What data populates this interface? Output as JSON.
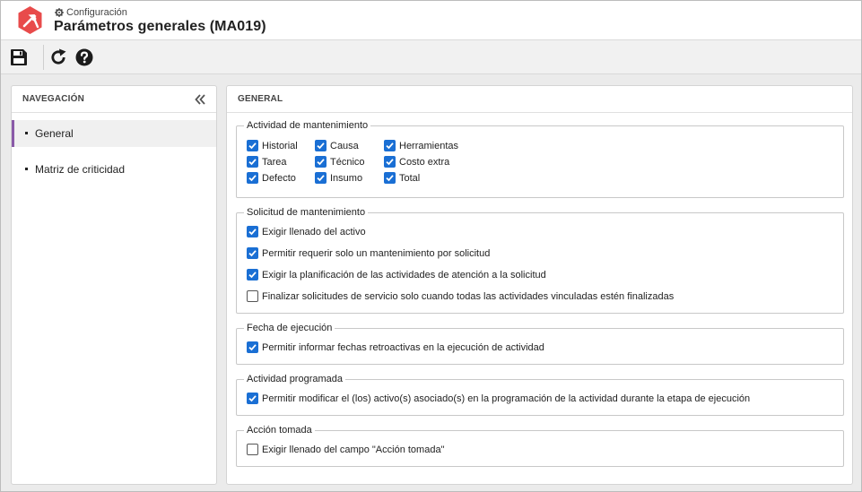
{
  "header": {
    "breadcrumb": "Configuración",
    "title": "Parámetros generales (MA019)",
    "logo_color": "#e84b4b"
  },
  "toolbar": {
    "buttons": [
      {
        "icon": "save-icon"
      },
      {
        "icon": "refresh-icon"
      },
      {
        "icon": "help-icon"
      }
    ]
  },
  "navigation": {
    "title": "NAVEGACIÓN",
    "items": [
      {
        "label": "General",
        "active": true
      },
      {
        "label": "Matriz de criticidad",
        "active": false
      }
    ],
    "active_color": "#8a5aa8"
  },
  "main": {
    "title": "GENERAL",
    "groups": [
      {
        "legend": "Actividad de mantenimiento",
        "options": [
          {
            "label": "Historial",
            "checked": true
          },
          {
            "label": "Causa",
            "checked": true
          },
          {
            "label": "Herramientas",
            "checked": true
          },
          {
            "label": "Tarea",
            "checked": true
          },
          {
            "label": "Técnico",
            "checked": true
          },
          {
            "label": "Costo extra",
            "checked": true
          },
          {
            "label": "Defecto",
            "checked": true
          },
          {
            "label": "Insumo",
            "checked": true
          },
          {
            "label": "Total",
            "checked": true
          }
        ]
      },
      {
        "legend": "Solicitud de mantenimiento",
        "options": [
          {
            "label": "Exigir llenado del activo",
            "checked": true
          },
          {
            "label": "Permitir requerir solo un mantenimiento por solicitud",
            "checked": true
          },
          {
            "label": "Exigir la planificación de las actividades de atención a la solicitud",
            "checked": true
          },
          {
            "label": "Finalizar solicitudes de servicio solo cuando todas las actividades vinculadas estén finalizadas",
            "checked": false
          }
        ]
      },
      {
        "legend": "Fecha de ejecución",
        "options": [
          {
            "label": "Permitir informar fechas retroactivas en la ejecución de actividad",
            "checked": true
          }
        ]
      },
      {
        "legend": "Actividad programada",
        "options": [
          {
            "label": "Permitir modificar el (los) activo(s) asociado(s) en la programación de la actividad durante la etapa de ejecución",
            "checked": true
          }
        ]
      },
      {
        "legend": "Acción tomada",
        "options": [
          {
            "label": "Exigir llenado del campo \"Acción tomada\"",
            "checked": false
          }
        ]
      }
    ],
    "checkbox_color": "#1a6fd4"
  }
}
